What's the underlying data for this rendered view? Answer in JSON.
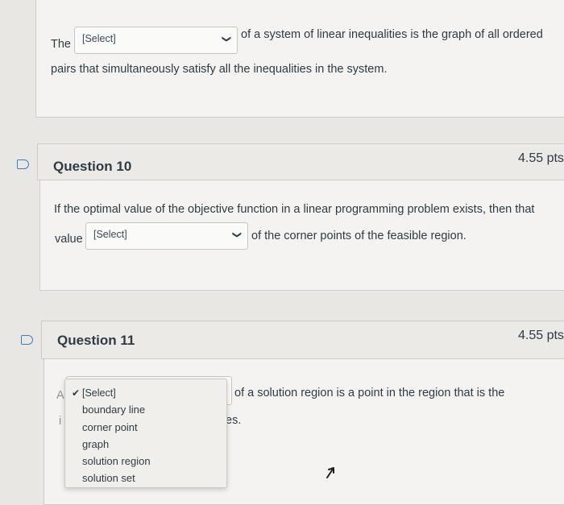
{
  "q9": {
    "before": "The",
    "select_value": "[Select]",
    "after_line1": "of a system of linear inequalities is the graph of all ordered",
    "line2": "pairs that simultaneously satisfy all the inequalities in the system."
  },
  "q10": {
    "title": "Question 10",
    "points": "4.55 pts",
    "line1": "If the optimal value of the objective function in a linear programming problem exists, then that",
    "before": "value",
    "select_value": "[Select]",
    "after": "of the corner points of the feasible region."
  },
  "q11": {
    "title": "Question 11",
    "points": "4.55 pts",
    "prefix_fragment": "A",
    "line2_fragment": "i",
    "after": "of a solution region is a point in the region that is the",
    "line2_tail": "es.",
    "dropdown": {
      "options": [
        "[Select]",
        "boundary line",
        "corner point",
        "graph",
        "solution region",
        "solution set"
      ],
      "selected": "[Select]"
    }
  },
  "icons": {
    "check": "✔",
    "chevron": "❯"
  }
}
